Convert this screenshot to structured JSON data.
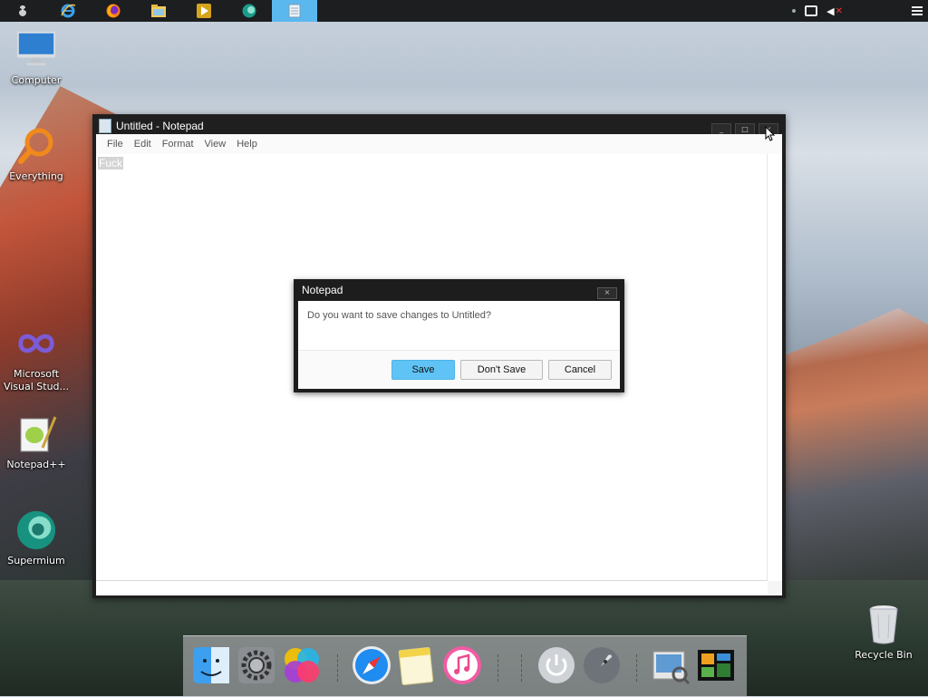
{
  "taskbar": {
    "apps": [
      {
        "name": "start",
        "icon": "start-icon",
        "active": false
      },
      {
        "name": "internet-explorer",
        "icon": "ie-icon",
        "active": false
      },
      {
        "name": "firefox",
        "icon": "firefox-icon",
        "active": false
      },
      {
        "name": "file-explorer",
        "icon": "folder-icon",
        "active": false
      },
      {
        "name": "media-player",
        "icon": "media-player-icon",
        "active": false
      },
      {
        "name": "supermium",
        "icon": "supermium-icon",
        "active": false
      },
      {
        "name": "notepad",
        "icon": "notepad-icon",
        "active": true
      }
    ],
    "active_color": "#5bb8ef"
  },
  "desktop": {
    "icons": [
      {
        "label": "Computer",
        "icon": "computer-icon"
      },
      {
        "label": "Everything",
        "icon": "search-magnifier-icon"
      },
      {
        "label": "Microsoft Visual Stud...",
        "icon": "visual-studio-icon"
      },
      {
        "label": "Notepad++",
        "icon": "notepad-plus-plus-icon"
      },
      {
        "label": "Supermium",
        "icon": "supermium-icon"
      },
      {
        "label": "Recycle Bin",
        "icon": "recycle-bin-icon"
      }
    ]
  },
  "notepad": {
    "title": "Untitled - Notepad",
    "menu": [
      "File",
      "Edit",
      "Format",
      "View",
      "Help"
    ],
    "content": "Fuck",
    "window_buttons": {
      "minimize": "_",
      "maximize": "□",
      "close": "×"
    }
  },
  "dialog": {
    "title": "Notepad",
    "message": "Do you want to save changes to Untitled?",
    "buttons": {
      "save": "Save",
      "dont_save": "Don't Save",
      "cancel": "Cancel"
    },
    "close": "×",
    "primary_color": "#60c3f5"
  },
  "dock": {
    "items": [
      {
        "name": "finder",
        "icon": "finder-icon"
      },
      {
        "name": "system-preferences",
        "icon": "gear-icon"
      },
      {
        "name": "game-center",
        "icon": "game-center-icon"
      },
      {
        "name": "safari",
        "icon": "safari-compass-icon"
      },
      {
        "name": "notes",
        "icon": "notes-icon"
      },
      {
        "name": "itunes",
        "icon": "itunes-icon"
      },
      {
        "name": "shutdown",
        "icon": "power-icon"
      },
      {
        "name": "launchpad",
        "icon": "rocket-icon"
      },
      {
        "name": "preview",
        "icon": "preview-icon"
      },
      {
        "name": "dashboard",
        "icon": "dashboard-icon"
      }
    ]
  }
}
